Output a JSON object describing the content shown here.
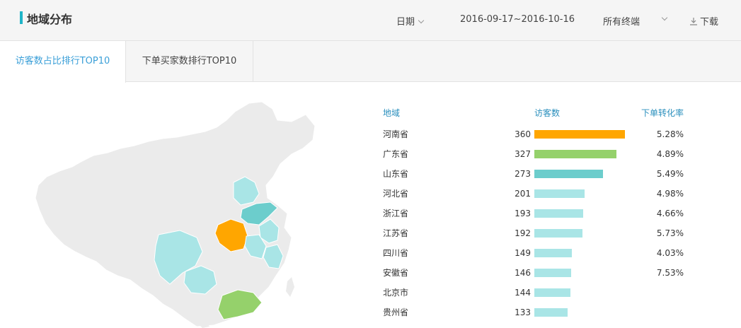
{
  "header": {
    "title": "地域分布",
    "date_label": "日期",
    "date_range": "2016-09-17~2016-10-16",
    "terminal_select": "所有终端",
    "download_label": "下载"
  },
  "tabs": [
    {
      "label": "访客数占比排行TOP10",
      "active": true
    },
    {
      "label": "下单买家数排行TOP10",
      "active": false
    }
  ],
  "table": {
    "columns": [
      "地域",
      "访客数",
      "下单转化率"
    ],
    "rows": [
      {
        "region": "河南省",
        "visitors": 360,
        "rate": "5.28%",
        "color": "#ffa600"
      },
      {
        "region": "广东省",
        "visitors": 327,
        "rate": "4.89%",
        "color": "#95d16b"
      },
      {
        "region": "山东省",
        "visitors": 273,
        "rate": "5.49%",
        "color": "#6ccdcc"
      },
      {
        "region": "河北省",
        "visitors": 201,
        "rate": "4.98%",
        "color": "#a9e5e6"
      },
      {
        "region": "浙江省",
        "visitors": 193,
        "rate": "4.66%",
        "color": "#a9e5e6"
      },
      {
        "region": "江苏省",
        "visitors": 192,
        "rate": "5.73%",
        "color": "#a9e5e6"
      },
      {
        "region": "四川省",
        "visitors": 149,
        "rate": "4.03%",
        "color": "#a9e5e6"
      },
      {
        "region": "安徽省",
        "visitors": 146,
        "rate": "7.53%",
        "color": "#a9e5e6"
      },
      {
        "region": "北京市",
        "visitors": 144,
        "rate": "",
        "color": "#a9e5e6"
      },
      {
        "region": "贵州省",
        "visitors": 133,
        "rate": "",
        "color": "#a9e5e6"
      }
    ]
  },
  "colors": {
    "accent": "#1fb5c8",
    "tab_active_text": "#3a9fd8",
    "map_base": "#ebebeb"
  }
}
